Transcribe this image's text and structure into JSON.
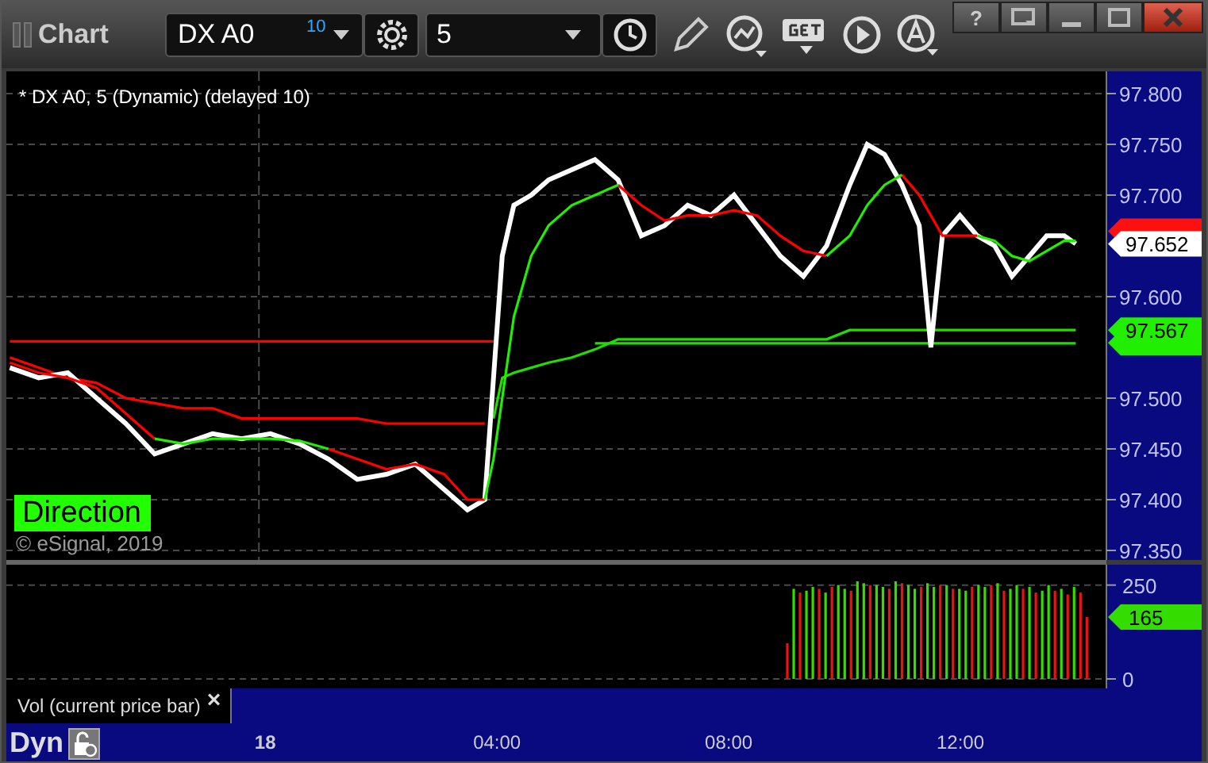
{
  "window": {
    "title": "Chart",
    "help_button": "?"
  },
  "toolbar": {
    "symbol": {
      "value": "DX A0",
      "badge": "10"
    },
    "interval": {
      "value": "5"
    }
  },
  "price_chart": {
    "legend": "* DX A0, 5 (Dynamic) (delayed 10)",
    "direction_label": "Direction",
    "copyright": "© eSignal, 2019",
    "price_tags": [
      {
        "kind": "covered",
        "color": "#ff1010"
      },
      {
        "kind": "label",
        "text": "97.652",
        "color": "#ffffff"
      },
      {
        "kind": "label",
        "text": "97.567",
        "color": "#22ee00"
      },
      {
        "kind": "covered",
        "color": "#22ee00"
      }
    ],
    "chart_data": {
      "type": "line",
      "grid": true,
      "xlim": [
        -4.36,
        14.63
      ],
      "ylim": [
        97.35,
        97.8
      ],
      "yticks": [
        {
          "value": 97.35,
          "label": "97.350"
        },
        {
          "value": 97.4,
          "label": "97.400"
        },
        {
          "value": 97.45,
          "label": "97.450"
        },
        {
          "value": 97.5,
          "label": "97.500"
        },
        {
          "value": 97.6,
          "label": "97.600"
        },
        {
          "value": 97.7,
          "label": "97.700"
        },
        {
          "value": 97.75,
          "label": "97.750"
        },
        {
          "value": 97.8,
          "label": "97.800"
        }
      ],
      "x": [
        -4.3,
        -3.8,
        -3.3,
        -2.8,
        -2.3,
        -1.8,
        -1.3,
        -0.8,
        -0.3,
        0.2,
        0.7,
        1.2,
        1.7,
        2.2,
        2.7,
        3.2,
        3.6,
        3.9,
        4.05,
        4.2,
        4.4,
        4.7,
        5.0,
        5.4,
        5.8,
        6.2,
        6.6,
        7.0,
        7.4,
        7.8,
        8.2,
        8.6,
        9.0,
        9.4,
        9.8,
        10.2,
        10.5,
        10.8,
        11.1,
        11.4,
        11.6,
        11.8,
        12.1,
        12.4,
        12.7,
        13.0,
        13.3,
        13.6,
        13.9,
        14.1
      ],
      "series": [
        {
          "color": "#ff0000",
          "values": [
            97.556,
            97.556,
            97.556,
            97.556,
            97.556,
            97.556,
            97.556,
            97.556,
            97.556,
            97.556,
            97.556,
            97.556,
            97.556,
            97.556,
            97.556,
            97.556,
            97.556,
            97.556,
            97.556,
            null,
            null,
            null,
            null,
            null,
            null,
            null,
            null,
            null,
            null,
            null,
            null,
            null,
            null,
            null,
            null,
            null,
            null,
            null,
            null,
            null,
            null,
            null,
            null,
            null,
            null,
            null,
            null,
            null,
            null,
            null
          ]
        },
        {
          "color": "#ff0000",
          "values": [
            97.54,
            97.53,
            97.52,
            97.515,
            97.5,
            97.495,
            97.49,
            97.49,
            97.48,
            97.48,
            97.48,
            97.48,
            97.48,
            97.475,
            97.475,
            97.475,
            97.475,
            97.475,
            null,
            null,
            null,
            null,
            null,
            null,
            null,
            null,
            null,
            null,
            null,
            null,
            null,
            null,
            null,
            null,
            null,
            null,
            null,
            null,
            null,
            null,
            null,
            null,
            null,
            null,
            null,
            null,
            null,
            null,
            null,
            null
          ]
        },
        {
          "color": "#22dd00",
          "values": [
            null,
            null,
            null,
            null,
            null,
            null,
            null,
            null,
            null,
            null,
            null,
            null,
            null,
            null,
            null,
            null,
            null,
            null,
            97.48,
            97.52,
            97.525,
            97.53,
            97.535,
            97.54,
            97.548,
            97.558,
            97.558,
            97.558,
            97.558,
            97.558,
            97.558,
            97.558,
            97.558,
            97.558,
            97.558,
            97.567,
            97.567,
            97.567,
            97.567,
            97.567,
            97.567,
            97.567,
            97.567,
            97.567,
            97.567,
            97.567,
            97.567,
            97.567,
            97.567,
            97.567
          ]
        },
        {
          "color": "#22dd00",
          "values": [
            null,
            null,
            null,
            null,
            null,
            null,
            null,
            null,
            null,
            null,
            null,
            null,
            null,
            null,
            null,
            null,
            null,
            null,
            null,
            null,
            null,
            null,
            null,
            null,
            97.554,
            97.554,
            97.554,
            97.554,
            97.554,
            97.554,
            97.554,
            97.554,
            97.554,
            97.554,
            97.554,
            97.554,
            97.554,
            97.554,
            97.554,
            97.554,
            97.554,
            97.554,
            97.554,
            97.554,
            97.554,
            97.554,
            97.554,
            97.554,
            97.554,
            97.554
          ]
        },
        {
          "color": "#ffffff",
          "values": [
            97.53,
            97.52,
            97.525,
            97.5,
            97.475,
            97.445,
            97.455,
            97.465,
            97.46,
            97.465,
            97.455,
            97.44,
            97.42,
            97.425,
            97.435,
            97.41,
            97.39,
            97.4,
            97.52,
            97.64,
            97.69,
            97.7,
            97.715,
            97.725,
            97.735,
            97.715,
            97.66,
            97.67,
            97.69,
            97.68,
            97.7,
            97.67,
            97.64,
            97.62,
            97.65,
            97.71,
            97.75,
            97.74,
            97.71,
            97.67,
            97.55,
            97.66,
            97.68,
            97.66,
            97.65,
            97.62,
            97.64,
            97.66,
            97.66,
            97.652
          ]
        },
        {
          "color": "#ff0000",
          "values": [
            97.535,
            97.525,
            97.52,
            97.51,
            97.485,
            97.46,
            null,
            null,
            null,
            null,
            null,
            97.45,
            97.44,
            97.43,
            97.435,
            97.425,
            97.4,
            97.4,
            null,
            null,
            null,
            null,
            null,
            null,
            null,
            97.71,
            97.69,
            97.675,
            97.68,
            97.68,
            97.685,
            97.68,
            97.66,
            97.645,
            97.64,
            null,
            null,
            null,
            97.72,
            97.7,
            97.68,
            97.66,
            97.66,
            97.66,
            null,
            null,
            null,
            null,
            null,
            null
          ]
        },
        {
          "color": "#22ee00",
          "values": [
            null,
            null,
            null,
            null,
            null,
            97.46,
            97.455,
            97.46,
            97.46,
            97.46,
            97.458,
            97.45,
            null,
            null,
            null,
            null,
            null,
            97.4,
            97.44,
            97.5,
            97.58,
            97.64,
            97.67,
            97.69,
            97.7,
            97.71,
            null,
            null,
            null,
            null,
            null,
            null,
            null,
            null,
            97.64,
            97.66,
            97.69,
            97.71,
            97.72,
            null,
            null,
            null,
            null,
            97.66,
            97.655,
            97.64,
            97.635,
            97.645,
            97.655,
            97.655
          ]
        }
      ]
    }
  },
  "volume_chart": {
    "price_tag": {
      "text": "165",
      "color": "#33dd00"
    },
    "chart_data": {
      "type": "bar",
      "stacked": true,
      "grid": true,
      "xlim": [
        -4.36,
        14.63
      ],
      "ylim": [
        0,
        300
      ],
      "yticks": [
        0,
        250
      ],
      "xticks": [
        {
          "value": 4,
          "label": "04:00"
        },
        {
          "value": 8,
          "label": "08:00"
        },
        {
          "value": 12,
          "label": "12:00"
        }
      ],
      "x": [
        9.1,
        9.21,
        9.32,
        9.43,
        9.54,
        9.65,
        9.76,
        9.87,
        9.98,
        10.09,
        10.2,
        10.31,
        10.42,
        10.53,
        10.64,
        10.75,
        10.86,
        10.97,
        11.08,
        11.19,
        11.3,
        11.41,
        11.52,
        11.63,
        11.74,
        11.85,
        11.96,
        12.07,
        12.18,
        12.29,
        12.4,
        12.51,
        12.62,
        12.73,
        12.84,
        12.95,
        13.06,
        13.17,
        13.28,
        13.39,
        13.5,
        13.61,
        13.72,
        13.83,
        13.94,
        14.05,
        14.16,
        14.27
      ],
      "series": [
        {
          "color": "#33dd00",
          "values": [
            null,
            240,
            null,
            235,
            245,
            null,
            230,
            null,
            250,
            240,
            null,
            260,
            255,
            null,
            250,
            245,
            null,
            260,
            null,
            250,
            240,
            null,
            255,
            245,
            null,
            250,
            null,
            240,
            235,
            null,
            250,
            245,
            null,
            255,
            null,
            240,
            250,
            null,
            245,
            null,
            235,
            250,
            null,
            240,
            null,
            245,
            null,
            null
          ]
        },
        {
          "color": "#ee1111",
          "values": [
            95,
            null,
            230,
            null,
            null,
            240,
            null,
            245,
            null,
            null,
            235,
            null,
            null,
            250,
            null,
            null,
            240,
            null,
            255,
            null,
            null,
            245,
            null,
            null,
            250,
            null,
            240,
            null,
            null,
            245,
            null,
            null,
            250,
            null,
            235,
            null,
            null,
            240,
            null,
            230,
            null,
            null,
            235,
            null,
            225,
            null,
            230,
            165
          ]
        }
      ]
    }
  },
  "study_label": {
    "text": "Vol (current price bar)",
    "close": "×"
  },
  "x_axis": {
    "mode": "Dyn",
    "date_label": "18"
  }
}
